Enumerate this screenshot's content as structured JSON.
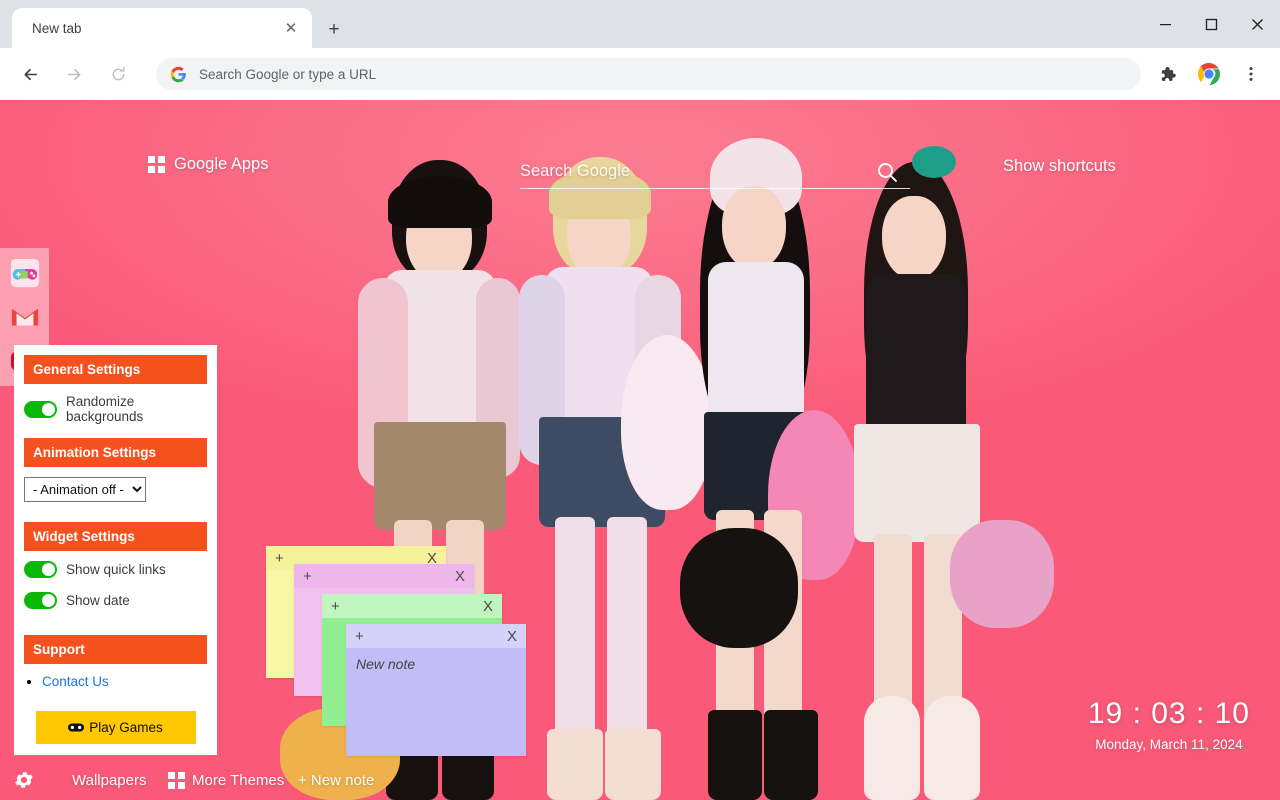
{
  "browser": {
    "tab_title": "New tab",
    "tab_close_label": "✕",
    "new_tab_label": "+",
    "window_minimize": "—",
    "window_maximize": "☐",
    "window_close": "✕",
    "back_icon": "back-arrow-icon",
    "forward_icon": "forward-arrow-icon",
    "reload_icon": "reload-icon",
    "omnibox_placeholder": "Search Google or type a URL",
    "omnibox_value": "",
    "extensions_icon": "puzzle-piece-icon",
    "profile_icon": "chrome-logo-icon",
    "menu_icon": "three-dot-menu-icon"
  },
  "newtab": {
    "google_apps_label": "Google Apps",
    "search_placeholder": "Search Google",
    "search_value": "",
    "search_button_icon": "magnifier-icon",
    "show_shortcuts_label": "Show shortcuts"
  },
  "quick_links": [
    {
      "name": "games",
      "icon": "gamepad-icon"
    },
    {
      "name": "gmail",
      "icon": "gmail-icon"
    },
    {
      "name": "youtube",
      "icon": "youtube-icon"
    }
  ],
  "settings": {
    "general_header": "General Settings",
    "randomize_label": "Randomize backgrounds",
    "randomize_on": true,
    "animation_header": "Animation Settings",
    "animation_selected": "- Animation off -",
    "animation_options": [
      "- Animation off -"
    ],
    "widget_header": "Widget Settings",
    "quick_links_label": "Show quick links",
    "quick_links_on": true,
    "show_date_label": "Show date",
    "show_date_on": true,
    "support_header": "Support",
    "contact_label": "Contact Us",
    "play_games_label": "Play Games",
    "play_games_icon": "gamepad-icon",
    "accent_header_color": "#f4511e",
    "toggle_on_color": "#0ab80a",
    "play_games_color": "#ffc800",
    "link_color": "#1a73e8"
  },
  "notes": [
    {
      "color": "#f8f7a8",
      "bar": "#f5f39a",
      "add": "+",
      "close": "X",
      "text": ""
    },
    {
      "color": "#f2c2ef",
      "bar": "#eeb6ea",
      "add": "+",
      "close": "X",
      "text": ""
    },
    {
      "color": "#91ef91",
      "bar": "#c0f5bf",
      "add": "+",
      "close": "X",
      "text": ""
    },
    {
      "color": "#c3bdf5",
      "bar": "#d6d1f8",
      "add": "+",
      "close": "X",
      "text": "New note"
    }
  ],
  "clock": {
    "time": "19 : 03 : 10",
    "date": "Monday, March 11, 2024"
  },
  "bottom_bar": {
    "settings_icon": "gear-icon",
    "wallpapers_label": "Wallpapers",
    "more_themes_label": "More Themes",
    "more_themes_icon": "grid-icon",
    "new_note_label": "+ New note"
  },
  "colors": {
    "background_pink": "#fa5f7c",
    "chrome_tabstrip": "#dee1e6",
    "toolbar_white": "#ffffff"
  }
}
